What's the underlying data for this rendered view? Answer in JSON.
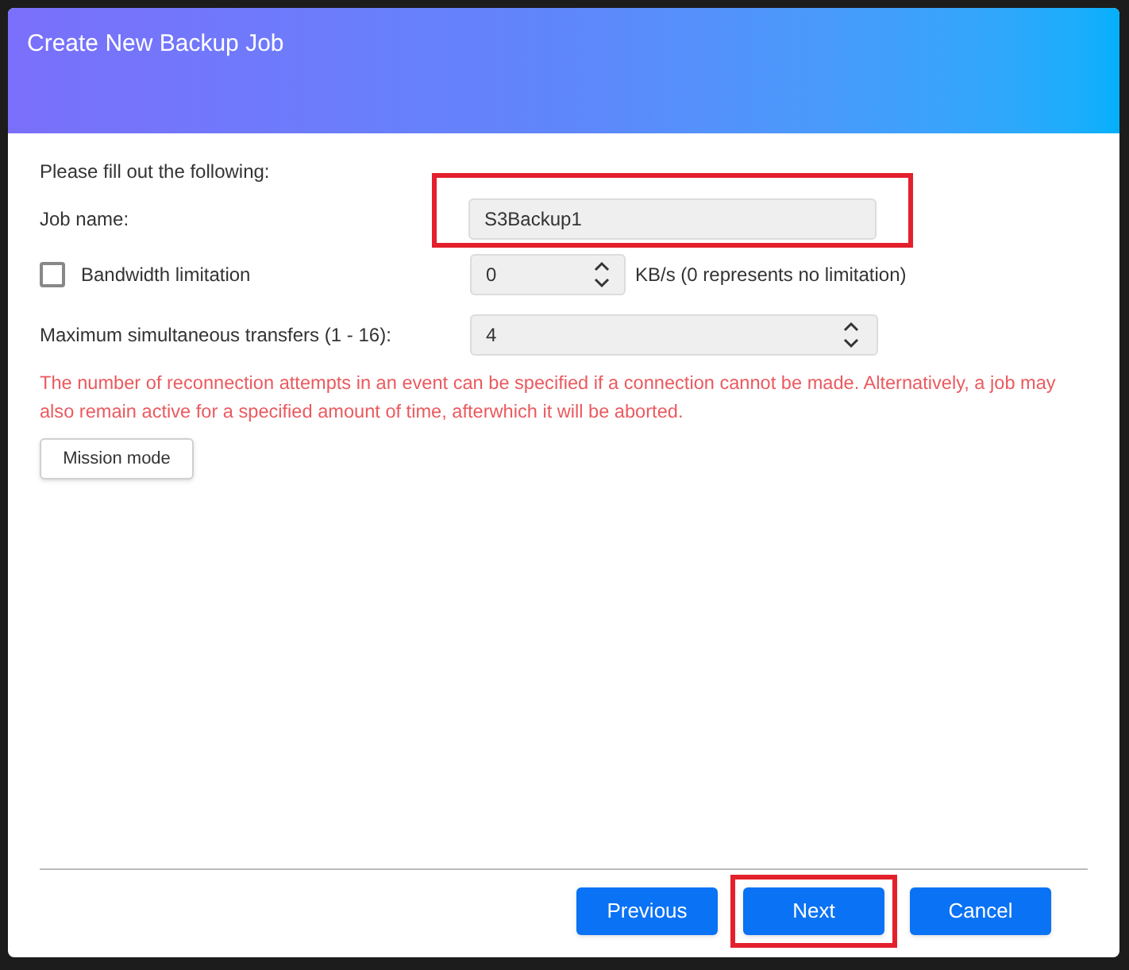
{
  "window": {
    "title": "Create New Backup Job"
  },
  "intro": "Please fill out the following:",
  "job_name": {
    "label": "Job name:",
    "value": "S3Backup1",
    "highlighted": true
  },
  "bandwidth": {
    "label": "Bandwidth limitation",
    "checked": false,
    "value": "0",
    "unit": "KB/s (0 represents no limitation)"
  },
  "max_transfers": {
    "label": "Maximum simultaneous transfers (1 - 16):",
    "value": "4"
  },
  "notice": "The number of reconnection attempts in an event can be specified if a connection cannot be made. Alternatively, a job may also remain active for a specified amount of time, afterwhich it will be aborted.",
  "mission_button": "Mission mode",
  "buttons": [
    {
      "label": "Previous",
      "highlighted": false
    },
    {
      "label": "Next",
      "highlighted": true
    },
    {
      "label": "Cancel",
      "highlighted": false
    }
  ]
}
